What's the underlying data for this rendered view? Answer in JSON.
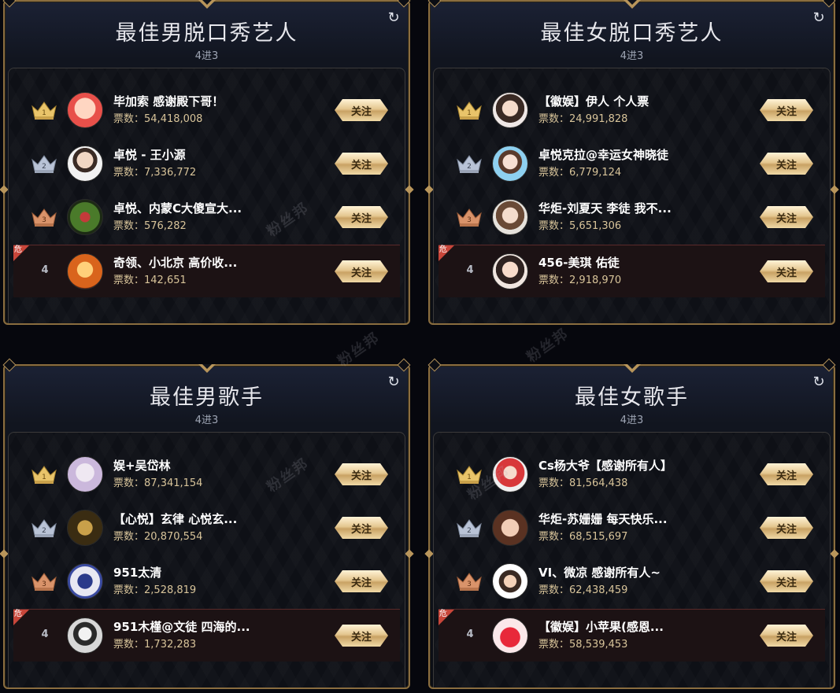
{
  "follow_label": "关注",
  "votes_label": "票数：",
  "danger_label": "危",
  "watermark": "粉丝邦",
  "panels": [
    {
      "title": "最佳男脱口秀艺人",
      "subtitle": "4进3",
      "rows": [
        {
          "rank": "1",
          "name": "毕加索 感谢殿下哥！",
          "votes": "54,418,008"
        },
        {
          "rank": "2",
          "name": "卓悦 - 王小源",
          "votes": "7,336,772"
        },
        {
          "rank": "3",
          "name": "卓悦、内蒙C大傻宣大...",
          "votes": "576,282"
        },
        {
          "rank": "4",
          "name": "奇领、小北京 高价收...",
          "votes": "142,651"
        }
      ]
    },
    {
      "title": "最佳女脱口秀艺人",
      "subtitle": "4进3",
      "rows": [
        {
          "rank": "1",
          "name": "【徽娱】伊人 个人票",
          "votes": "24,991,828"
        },
        {
          "rank": "2",
          "name": "卓悦克拉@幸运女神晓徒",
          "votes": "6,779,124"
        },
        {
          "rank": "3",
          "name": "华炬-刘夏天 李徒 我不...",
          "votes": "5,651,306"
        },
        {
          "rank": "4",
          "name": "456-美琪 佑徒",
          "votes": "2,918,970"
        }
      ]
    },
    {
      "title": "最佳男歌手",
      "subtitle": "4进3",
      "rows": [
        {
          "rank": "1",
          "name": "娱+吴岱林",
          "votes": "87,341,154"
        },
        {
          "rank": "2",
          "name": "【心悦】玄律 心悦玄...",
          "votes": "20,870,554"
        },
        {
          "rank": "3",
          "name": "951太清",
          "votes": "2,528,819"
        },
        {
          "rank": "4",
          "name": "951木槿@文徒 四海的...",
          "votes": "1,732,283"
        }
      ]
    },
    {
      "title": "最佳女歌手",
      "subtitle": "4进3",
      "rows": [
        {
          "rank": "1",
          "name": "Cs杨大爷【感谢所有人】",
          "votes": "81,564,438"
        },
        {
          "rank": "2",
          "name": "华炬-苏姗姗 每天快乐...",
          "votes": "68,515,697"
        },
        {
          "rank": "3",
          "name": "VI、微凉 感谢所有人~",
          "votes": "62,438,459"
        },
        {
          "rank": "4",
          "name": "【徽娱】小苹果(感恩...",
          "votes": "58,539,453"
        }
      ]
    }
  ],
  "colors": {
    "gold": "#b8955b",
    "crown_gold": "#e9c46a",
    "crown_silver": "#b9c3d6",
    "crown_bronze": "#d9936a",
    "danger": "#c8463a"
  },
  "icons": [
    "refresh-icon",
    "crown-gold-icon",
    "crown-silver-icon",
    "crown-bronze-icon"
  ]
}
